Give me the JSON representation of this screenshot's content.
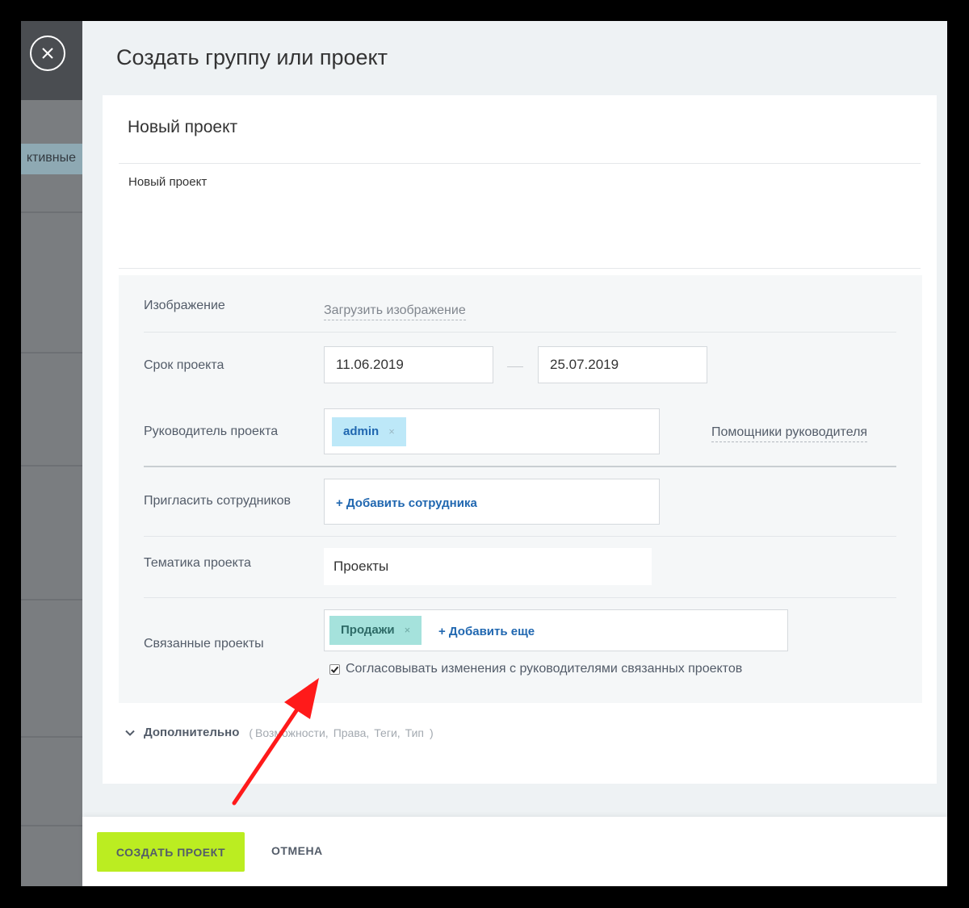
{
  "background": {
    "filter_label": "ктивные"
  },
  "slider": {
    "title": "Создать группу или проект"
  },
  "project": {
    "name": "Новый проект",
    "description": "Новый проект"
  },
  "settings": {
    "image": {
      "label": "Изображение",
      "upload_link": "Загрузить изображение"
    },
    "deadline": {
      "label": "Срок проекта",
      "start": "11.06.2019",
      "end": "25.07.2019"
    },
    "owner": {
      "label": "Руководитель проекта",
      "tag": "admin",
      "tag_remove": "×",
      "assistants_link": "Помощники руководителя"
    },
    "invite": {
      "label": "Пригласить сотрудников",
      "add_link": "+ Добавить сотрудника"
    },
    "subject": {
      "label": "Тематика проекта",
      "value": "Проекты"
    },
    "related": {
      "label": "Связанные проекты",
      "tag": "Продажи",
      "tag_remove": "×",
      "add_link": "+ Добавить еще",
      "checkbox_label": "Согласовывать изменения с руководителями связанных проектов",
      "checkbox_checked": true
    }
  },
  "advanced": {
    "title": "Дополнительно",
    "open_paren": "(",
    "close_paren": ")",
    "options": [
      "Возможности,",
      "Права,",
      "Теги,",
      "Тип"
    ]
  },
  "footer": {
    "create_label": "СОЗДАТЬ ПРОЕКТ",
    "cancel_label": "ОТМЕНА"
  },
  "colors": {
    "accent": "#bbed21",
    "link": "#2067b0",
    "arrow": "#ff1a1a"
  }
}
